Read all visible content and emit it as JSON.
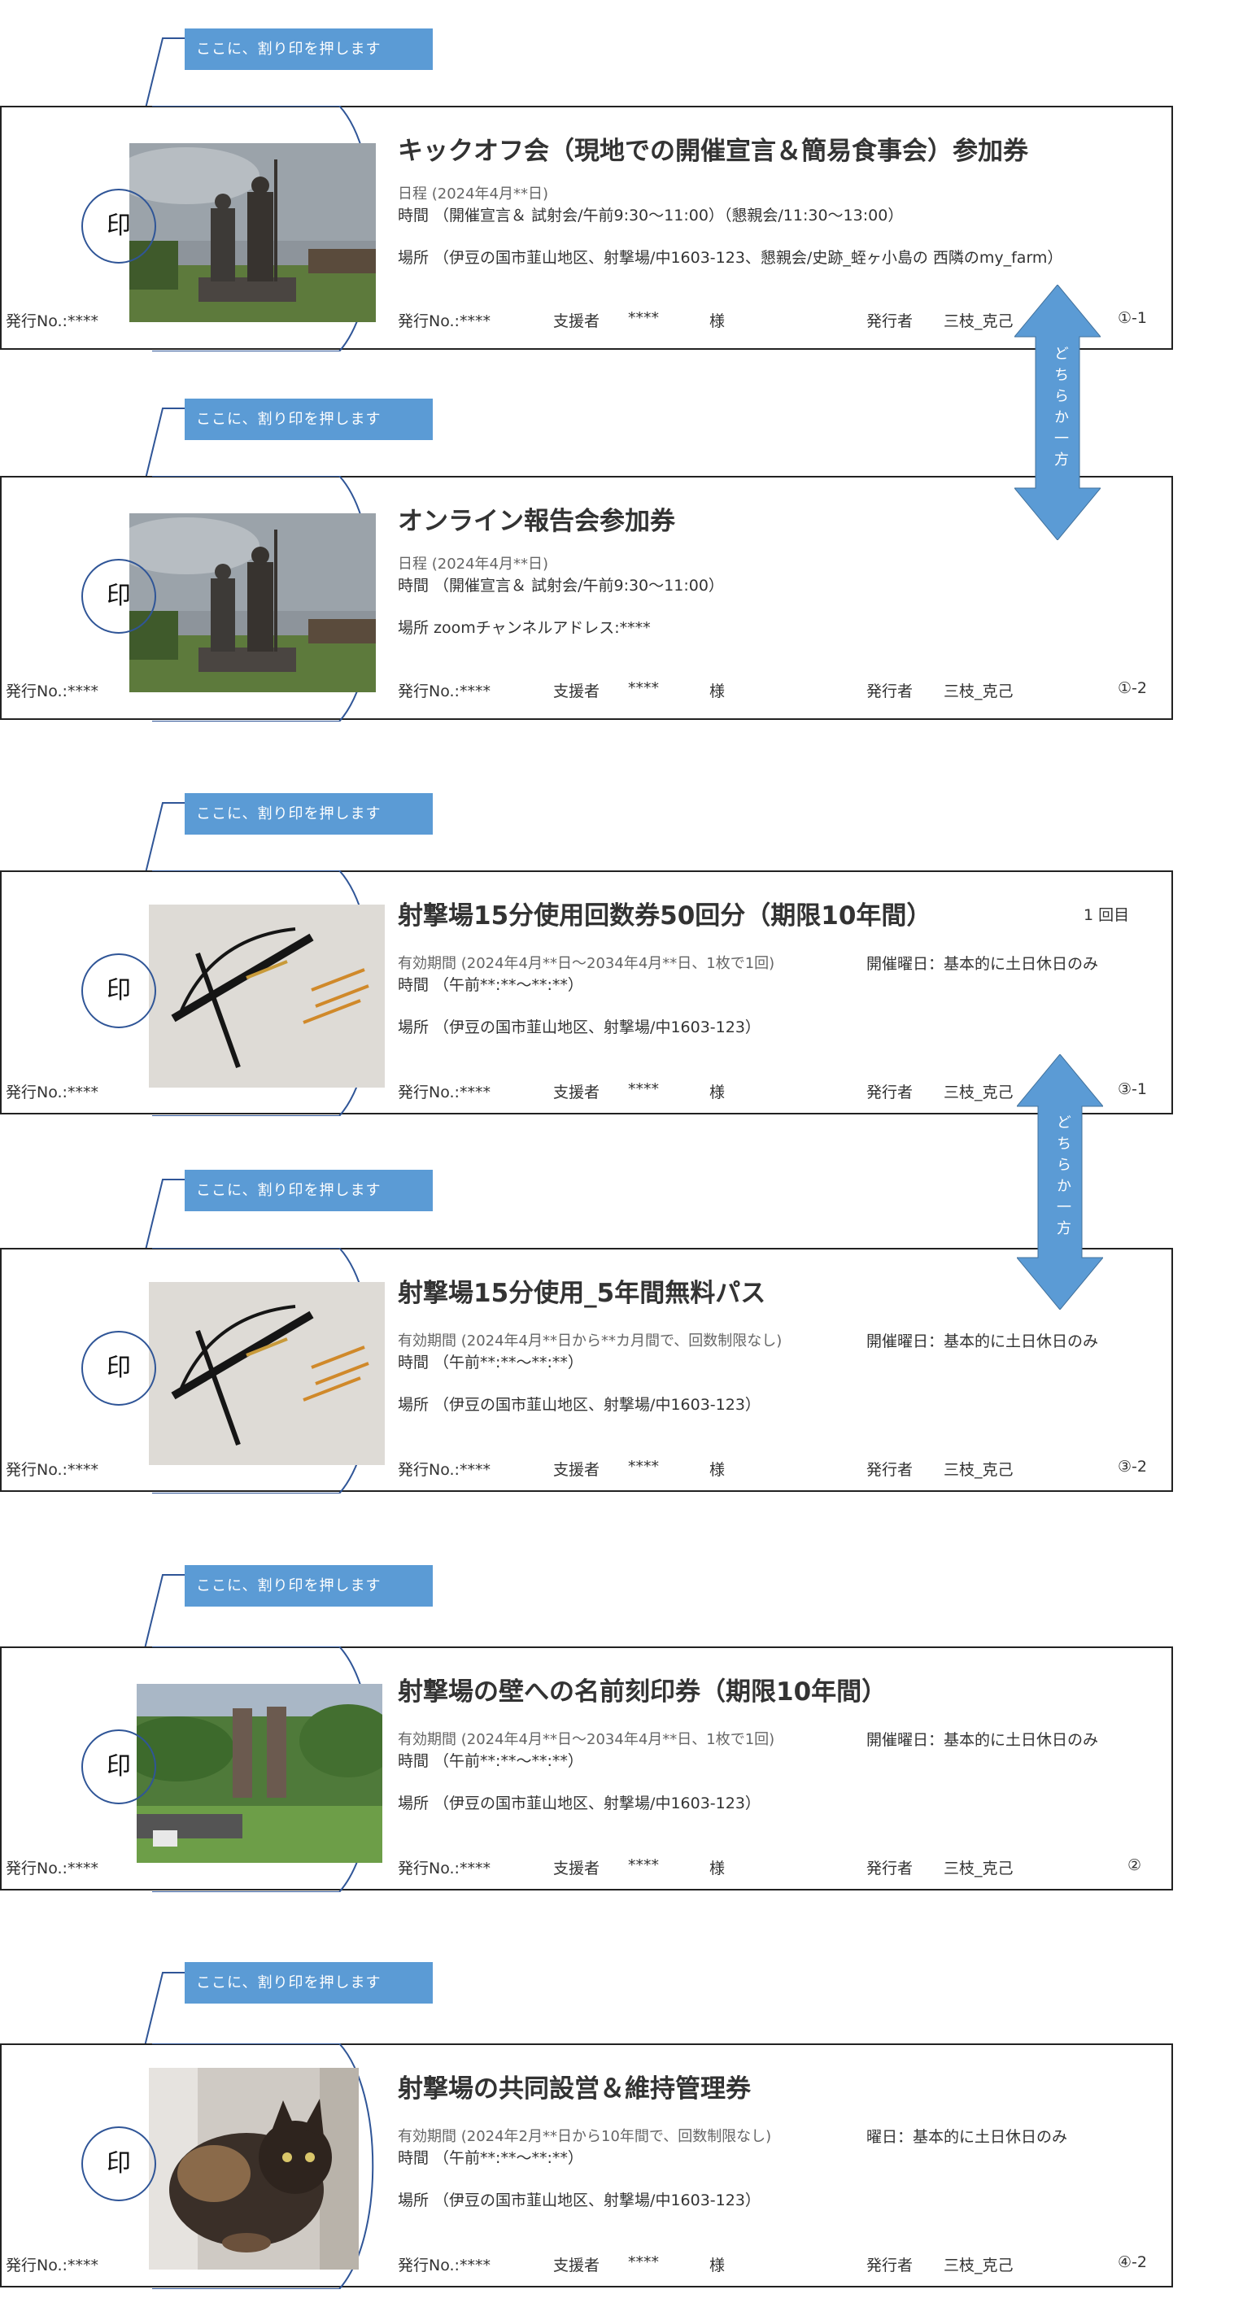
{
  "callout_text": "ここに、割り印を押します",
  "seal_text": "印",
  "either_text": "どちらか一方",
  "common": {
    "issue_no": "発行No.:****",
    "supporter_label": "支援者",
    "supporter_value": "****",
    "honorific": "様",
    "issuer_label": "発行者",
    "issuer_name": "三枝_克己"
  },
  "tickets": [
    {
      "title": "キックオフ会（現地での開催宣言＆簡易食事会）参加券",
      "line1": "日程  (2024年4月**日)",
      "line2": "時間 （開催宣言＆ 試射会/午前9:30〜11:00）（懇親会/11:30〜13:00）",
      "place": "場所 （伊豆の国市韮山地区、射撃場/中1603-123、懇親会/史跡_蛭ヶ小島の 西隣のmy_farm）",
      "extra": "",
      "count": "",
      "code": "①-1",
      "photo": "statues"
    },
    {
      "title": "オンライン報告会参加券",
      "line1": "日程  (2024年4月**日)",
      "line2": "時間 （開催宣言＆ 試射会/午前9:30〜11:00）",
      "place": "場所   zoomチャンネルアドレス:****",
      "extra": "",
      "count": "",
      "code": "①-2",
      "photo": "statues"
    },
    {
      "title": "射撃場15分使用回数券50回分（期限10年間）",
      "line1": "有効期間  (2024年4月**日〜2034年4月**日、1枚で1回)",
      "line2": "時間 （午前**:**〜**:**）",
      "place": "場所 （伊豆の国市韮山地区、射撃場/中1603-123）",
      "extra": "開催曜日：基本的に土日休日のみ",
      "count": "1   回目",
      "code": "③-1",
      "photo": "crossbow"
    },
    {
      "title": "射撃場15分使用_5年間無料パス",
      "line1": "有効期間  (2024年4月**日から**カ月間で、回数制限なし)",
      "line2": "時間 （午前**:**〜**:**）",
      "place": "場所 （伊豆の国市韮山地区、射撃場/中1603-123）",
      "extra": "開催曜日：基本的に土日休日のみ",
      "count": "",
      "code": "③-2",
      "photo": "crossbow"
    },
    {
      "title": "射撃場の壁への名前刻印券（期限10年間）",
      "line1": "有効期間  (2024年4月**日〜2034年4月**日、1枚で1回)",
      "line2": "時間 （午前**:**〜**:**）",
      "place": "場所 （伊豆の国市韮山地区、射撃場/中1603-123）",
      "extra": "開催曜日：基本的に土日休日のみ",
      "count": "",
      "code": "②",
      "photo": "furnace"
    },
    {
      "title": "射撃場の共同設営＆維持管理券",
      "line1": "有効期間  (2024年2月**日から10年間で、回数制限なし)",
      "line2": "時間 （午前**:**〜**:**）",
      "place": "場所 （伊豆の国市韮山地区、射撃場/中1603-123）",
      "extra": "曜日：基本的に土日休日のみ",
      "count": "",
      "code": "④-2",
      "photo": "cat"
    }
  ],
  "colors": {
    "accent": "#5b9bd5",
    "seal_border": "#2f5597"
  }
}
